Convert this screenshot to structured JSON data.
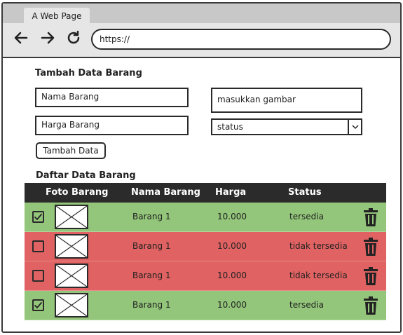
{
  "browser": {
    "tab_title": "A Web Page",
    "url": "https://"
  },
  "form": {
    "title": "Tambah Data Barang",
    "name_placeholder": "Nama Barang",
    "price_placeholder": "Harga Barang",
    "image_placeholder": "masukkan gambar",
    "status_selected": "status",
    "submit_label": "Tambah Data"
  },
  "table": {
    "title": "Daftar Data Barang",
    "headers": {
      "photo": "Foto Barang",
      "name": "Nama Barang",
      "price": "Harga",
      "status": "Status"
    },
    "rows": [
      {
        "checked": true,
        "name": "Barang 1",
        "price": "10.000",
        "status": "tersedia",
        "color": "#93c67a"
      },
      {
        "checked": false,
        "name": "Barang 1",
        "price": "10.000",
        "status": "tidak tersedia",
        "color": "#e06262"
      },
      {
        "checked": false,
        "name": "Barang 1",
        "price": "10.000",
        "status": "tidak tersedia",
        "color": "#e06262"
      },
      {
        "checked": true,
        "name": "Barang 1",
        "price": "10.000",
        "status": "tersedia",
        "color": "#93c67a"
      }
    ]
  },
  "icons": {
    "back": "arrow-left-icon",
    "forward": "arrow-right-icon",
    "reload": "reload-icon",
    "delete": "trash-icon",
    "image": "image-placeholder-icon"
  }
}
